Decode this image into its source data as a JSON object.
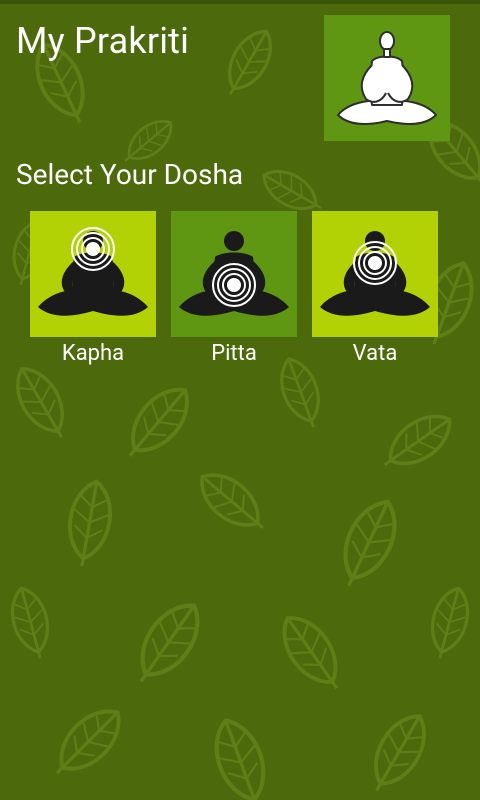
{
  "app": {
    "title": "My Prakriti",
    "logo_icon": "meditation-outline-icon"
  },
  "section": {
    "heading": "Select Your Dosha"
  },
  "doshas": [
    {
      "label": "Kapha",
      "icon": "meditation-head-chakra-icon",
      "tile_color": "#b3d206"
    },
    {
      "label": "Pitta",
      "icon": "meditation-navel-chakra-icon",
      "tile_color": "#5f9712"
    },
    {
      "label": "Vata",
      "icon": "meditation-chest-chakra-icon",
      "tile_color": "#b3d206"
    }
  ],
  "colors": {
    "background": "#4c6a0c",
    "leaf_pattern": "#5f7e18",
    "logo_tile": "#5f9712",
    "text": "#ffffff"
  }
}
